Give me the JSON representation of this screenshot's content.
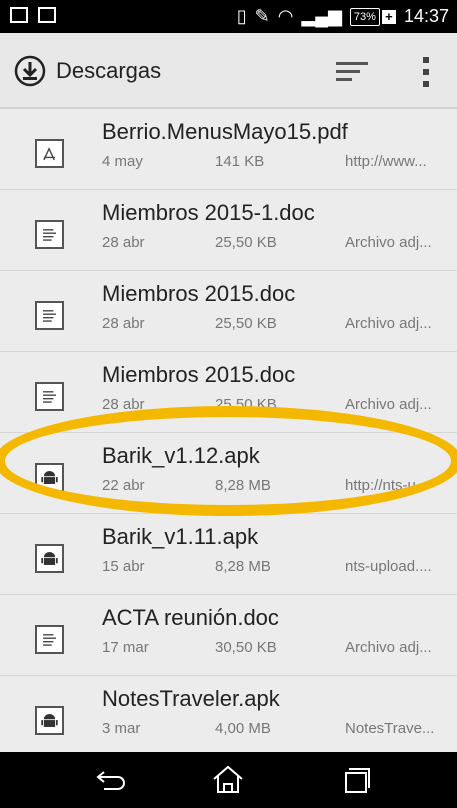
{
  "status_bar": {
    "battery": "73%",
    "time": "14:37"
  },
  "action_bar": {
    "title": "Descargas"
  },
  "items": [
    {
      "name": "Berrio.MenusMayo15.pdf",
      "date": "4 may",
      "size": "141 KB",
      "source": "http://www...",
      "type": "pdf"
    },
    {
      "name": "Miembros  2015-1.doc",
      "date": "28 abr",
      "size": "25,50 KB",
      "source": "Archivo adj...",
      "type": "doc"
    },
    {
      "name": "Miembros  2015.doc",
      "date": "28 abr",
      "size": "25,50 KB",
      "source": "Archivo adj...",
      "type": "doc"
    },
    {
      "name": "Miembros  2015.doc",
      "date": "28 abr",
      "size": "25,50 KB",
      "source": "Archivo adj...",
      "type": "doc"
    },
    {
      "name": "Barik_v1.12.apk",
      "date": "22 abr",
      "size": "8,28 MB",
      "source": "http://nts-u...",
      "type": "apk"
    },
    {
      "name": "Barik_v1.11.apk",
      "date": "15 abr",
      "size": "8,28 MB",
      "source": "nts-upload....",
      "type": "apk"
    },
    {
      "name": "ACTA reunión.doc",
      "date": "17 mar",
      "size": "30,50 KB",
      "source": "Archivo adj...",
      "type": "doc"
    },
    {
      "name": "NotesTraveler.apk",
      "date": "3 mar",
      "size": "4,00 MB",
      "source": "NotesTrave...",
      "type": "apk"
    }
  ],
  "icons": {
    "download": "download-icon",
    "sort": "sort-icon",
    "menu": "overflow-menu-icon",
    "back": "back-icon",
    "home": "home-icon",
    "recents": "recents-icon"
  },
  "highlight_color": "#f5b800"
}
